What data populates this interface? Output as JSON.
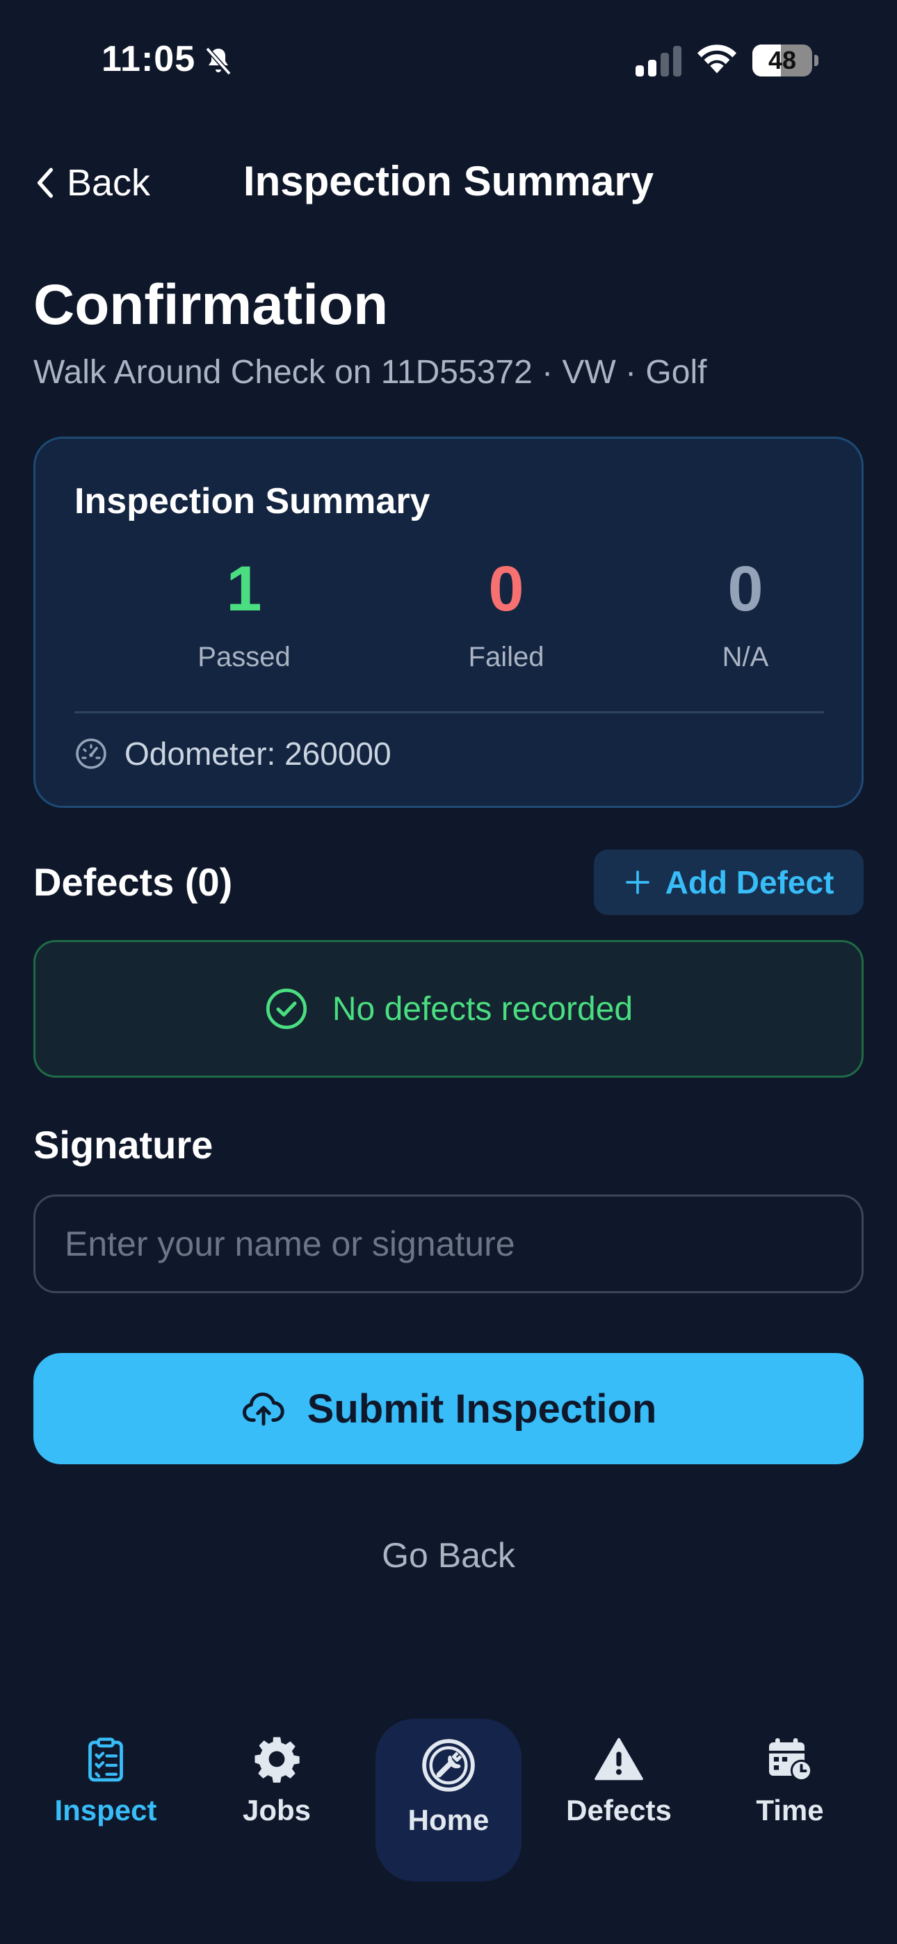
{
  "status_bar": {
    "time": "11:05",
    "battery_level": "48",
    "battery_fraction": 0.48
  },
  "nav": {
    "back_label": "Back",
    "title": "Inspection Summary"
  },
  "header": {
    "title": "Confirmation",
    "subtitle": "Walk Around Check on 11D55372 · VW · Golf"
  },
  "summary_card": {
    "title": "Inspection Summary",
    "stats": [
      {
        "value": "1",
        "label": "Passed",
        "color": "#4ade80"
      },
      {
        "value": "0",
        "label": "Failed",
        "color": "#f87171"
      },
      {
        "value": "0",
        "label": "N/A",
        "color": "#94a3b8"
      }
    ],
    "odometer": "Odometer: 260000",
    "odometer_icon": "speedometer-icon"
  },
  "defects": {
    "title": "Defects (0)",
    "add_label": "Add Defect",
    "empty_text": "No defects recorded"
  },
  "signature": {
    "title": "Signature",
    "placeholder": "Enter your name or signature",
    "value": ""
  },
  "actions": {
    "submit_label": "Submit Inspection",
    "submit_icon": "cloud-upload-icon",
    "go_back_label": "Go Back"
  },
  "tab_bar": {
    "tabs": [
      {
        "label": "Inspect",
        "icon": "clipboard-check-icon",
        "active": true
      },
      {
        "label": "Jobs",
        "icon": "gear-icon",
        "active": false
      },
      {
        "label": "Home",
        "icon": "wrench-circle-icon",
        "active": false
      },
      {
        "label": "Defects",
        "icon": "warning-triangle-icon",
        "active": false
      },
      {
        "label": "Time",
        "icon": "calendar-clock-icon",
        "active": false
      }
    ],
    "active_color": "#38bdf8"
  },
  "colors": {
    "background": "#0f172a",
    "accent": "#38bdf8",
    "passed": "#4ade80",
    "failed": "#f87171"
  }
}
